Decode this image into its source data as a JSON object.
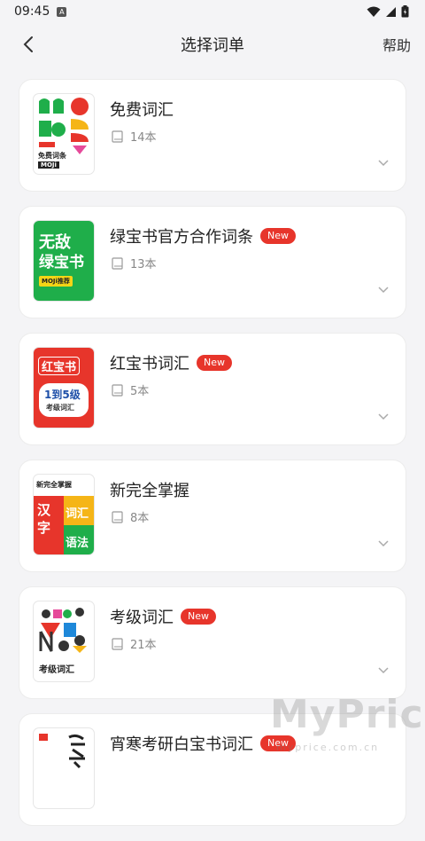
{
  "status_bar": {
    "time": "09:45",
    "badge": "A"
  },
  "nav": {
    "title": "选择词单",
    "help": "帮助"
  },
  "cards": [
    {
      "title": "免费词汇",
      "count": "14本",
      "is_new": false,
      "new_label": "",
      "cover": {
        "line1": "免费词条",
        "line2": "MOJi"
      }
    },
    {
      "title": "绿宝书官方合作词条",
      "count": "13本",
      "is_new": true,
      "new_label": "New",
      "cover": {
        "line1": "无敌",
        "line2": "绿宝书",
        "tag": "MOJi推荐"
      }
    },
    {
      "title": "红宝书词汇",
      "count": "5本",
      "is_new": true,
      "new_label": "New",
      "cover": {
        "line1": "红宝书",
        "line2": "1到5级",
        "line3": "考级词汇"
      }
    },
    {
      "title": "新完全掌握",
      "count": "8本",
      "is_new": false,
      "new_label": "",
      "cover": {
        "top": "新完全掌握",
        "left": "汉字",
        "right1": "词汇",
        "right2": "语法"
      }
    },
    {
      "title": "考级词汇",
      "count": "21本",
      "is_new": true,
      "new_label": "New",
      "cover": {
        "bottom": "考级词汇"
      }
    },
    {
      "title": "宵寒考研白宝书词汇",
      "count": "",
      "is_new": true,
      "new_label": "New",
      "cover": {}
    }
  ],
  "watermark": {
    "text": "MyPrice",
    "sub": "myprice.com.cn"
  },
  "colors": {
    "accent_red": "#e7352b",
    "green": "#1fae4a",
    "background": "#f4f4f6"
  }
}
